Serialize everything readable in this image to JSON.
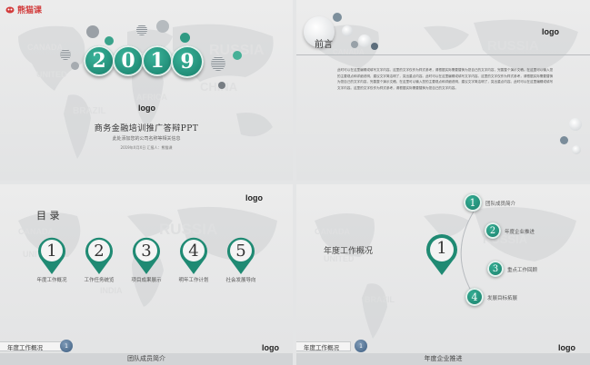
{
  "brand": {
    "label": "熊猫课"
  },
  "slide1": {
    "digits": [
      "2",
      "0",
      "1",
      "9"
    ],
    "logo": "logo",
    "title": "商务金融培训推广答辩PPT",
    "subtitle": "此处添加您的公司名称等相关信息",
    "meta": "2019年X月X日   汇报人：熊猫课"
  },
  "slide2": {
    "title": "前言",
    "logo": "logo",
    "paragraph": "此时可以在这里编辑或填写文字内容。这里的文字仅作为样式参考，请根据实际需要替换为您自己的文字内容，完善整个演示文稿。在这里可以输入您的主要观点和详细说明，建议文字简洁明了，突出重点内容。此时可以在这里编辑或填写文字内容。这里的文字仅作为样式参考，请根据实际需要替换为您自己的文字内容，完善整个演示文稿。在这里可以输入您的主要观点和详细说明，建议文字简洁明了，突出重点内容。此时可以在这里编辑或填写文字内容。这里的文字仅作为样式参考，请根据实际需要替换为您自己的文字内容。"
  },
  "slide3": {
    "title": "目 录",
    "logo": "logo",
    "items": [
      {
        "num": "1",
        "label": "年度工作概况"
      },
      {
        "num": "2",
        "label": "工作任务统览"
      },
      {
        "num": "3",
        "label": "项目成果展示"
      },
      {
        "num": "4",
        "label": "明年工作计划"
      },
      {
        "num": "5",
        "label": "社会发展导向"
      }
    ],
    "footer": {
      "label": "年度工作概况",
      "badge": "1",
      "section": "团队成员简介",
      "logo": "logo"
    }
  },
  "slide4": {
    "heading": "年度工作概况",
    "center_num": "1",
    "items": [
      {
        "num": "1",
        "label": "团队成员简介"
      },
      {
        "num": "2",
        "label": "年度企业推进"
      },
      {
        "num": "3",
        "label": "重点工作回顾"
      },
      {
        "num": "4",
        "label": "发展目标拓展"
      }
    ],
    "footer": {
      "label": "年度工作概况",
      "badge": "1",
      "section": "年度企业推进",
      "logo": "logo"
    }
  },
  "colors": {
    "accent": "#1f8a73",
    "dark": "#165f52",
    "grey": "#7a7f85"
  }
}
